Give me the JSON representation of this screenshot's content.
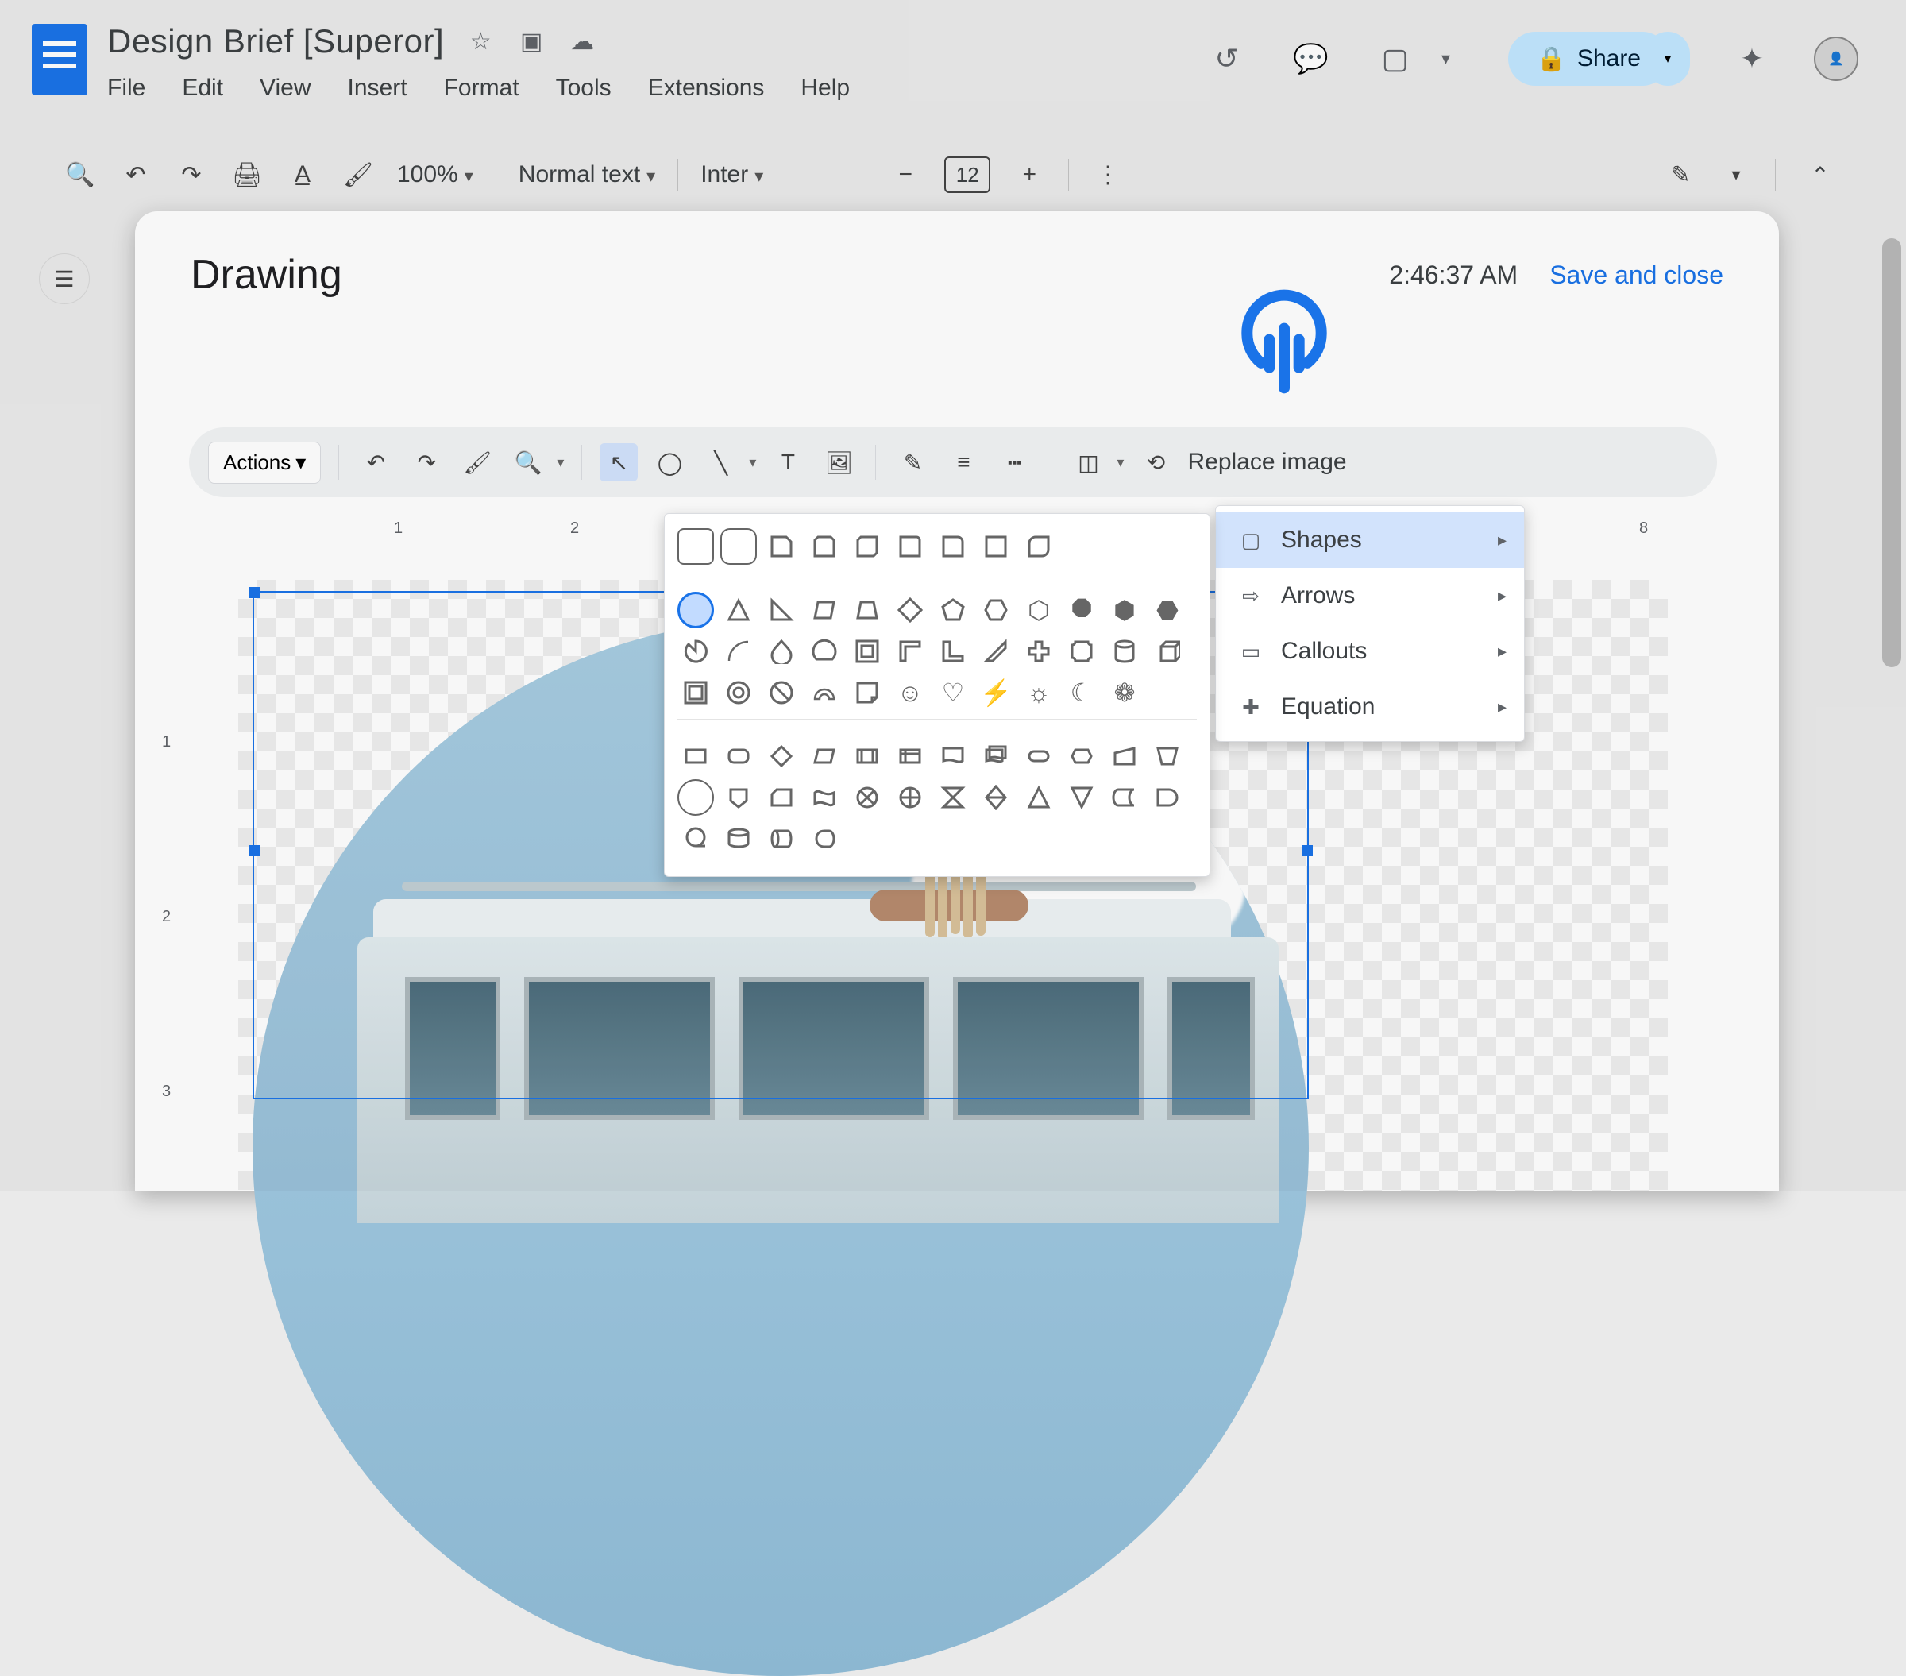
{
  "doc": {
    "title": "Design Brief [Superor]",
    "menus": [
      "File",
      "Edit",
      "View",
      "Insert",
      "Format",
      "Tools",
      "Extensions",
      "Help"
    ]
  },
  "share": {
    "label": "Share"
  },
  "toolbar": {
    "zoom": "100%",
    "style": "Normal text",
    "font": "Inter",
    "font_size": "12"
  },
  "drawing": {
    "title": "Drawing",
    "timestamp": "2:46:37 AM",
    "save_close": "Save and close",
    "actions_label": "Actions",
    "replace_image": "Replace image"
  },
  "ruler_h": [
    "1",
    "2",
    "8"
  ],
  "ruler_v": [
    "1",
    "2",
    "3"
  ],
  "crop_menu": {
    "shapes": "Shapes",
    "arrows": "Arrows",
    "callouts": "Callouts",
    "equation": "Equation"
  }
}
